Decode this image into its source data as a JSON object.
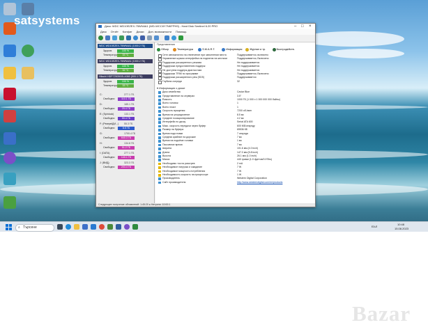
{
  "watermark": "satsystems",
  "window": {
    "title": "Диск: WDC WD10EZEX-75WN4A1 (WD-WCC6Y7NKFPH9) - Hard Disk Sentinel 6.20 PRO",
    "menu": [
      "Диск",
      "Отчёт",
      "Конфиг",
      "Диски",
      "Доп. возможности",
      "Помощь"
    ]
  },
  "disks": [
    {
      "name": "WDC WD10EZEX-75WN4A1 (1000.2 ГБ)",
      "health_label": "Здоров.",
      "health": "100 %",
      "temp_label": "Температура",
      "temp": "33 °C",
      "health_val": 100
    },
    {
      "name": "WDC WD10EZEX-75WN4A1 (1000.2 ГБ)",
      "health_label": "Здоров.",
      "health": "100 %",
      "temp_label": "Температура",
      "temp": "32 °C",
      "health_val": 100
    },
    {
      "name": "Hitachi HDP725050GLA360 (500.1 ГБ)",
      "health_label": "Здоров.",
      "health": "100 %",
      "temp_label": "Температура",
      "temp": "33 °C",
      "health_val": 100
    }
  ],
  "volumes": [
    {
      "letter": "C:",
      "cap": "277.1 ГБ",
      "free_label": "Свободно",
      "free": "110.1 ГБ",
      "color": "#8e3cc8"
    },
    {
      "letter": "D:",
      "cap": "185.1 ГБ",
      "free_label": "Свободно",
      "free": "25.4 ГБ",
      "color": "#8e3cc8"
    },
    {
      "letter": "E: (Spinlock)",
      "cap": "133.1 ГБ",
      "free_label": "Свободно",
      "free": "59.4 ГБ",
      "color": "#6a3cc8"
    },
    {
      "letter": "F: (Резерв/ДИ...)",
      "cap": "55.3 ГБ",
      "free_label": "Свободно",
      "free": "8.5 ГБ",
      "color": "#2f5ccc"
    },
    {
      "letter": "G:",
      "cap": "1700.4 ГБ",
      "free_label": "Свободно",
      "free": "640.3 ГБ",
      "color": "#c83cae"
    },
    {
      "letter": "H:",
      "cap": "134.8 ГБ",
      "free_label": "Свободно",
      "free": "51.2 ГБ",
      "color": "#c83cae"
    },
    {
      "letter": "I: (DATA)",
      "cap": "277.1 ГБ",
      "free_label": "Свободно",
      "free": "140.1 ГБ",
      "color": "#c83cae"
    },
    {
      "letter": "J: (ВИД)",
      "cap": "323.3 ГБ",
      "free_label": "Свободно",
      "free": "203.4 ГБ",
      "color": "#c83cae"
    }
  ],
  "tabs": [
    "Обзор",
    "Температура",
    "S.M.A.R.T.",
    "Информация",
    "Журнал и тр.",
    "Быстродейств."
  ],
  "features_head": "Представления",
  "features": [
    {
      "k": "Сетл автоматично на отвлечение при заполнении места",
      "v": "Поддерживается, включено"
    },
    {
      "k": "Управление шумом интерфейса на поднятии на жестком",
      "v": "Поддерживается, Включено"
    },
    {
      "k": "Поддержка расширенного режима",
      "v": "Не поддерживается"
    },
    {
      "k": "Поддержка предоставлению поддерж",
      "v": "Не поддерживается"
    },
    {
      "k": "Не доступна поддерж диагностики",
      "v": "Не поддерживается"
    },
    {
      "k": "Поддержка TRIM по программе",
      "v": "Поддерживается, Включено"
    },
    {
      "k": "Поддержка расширенного реж (SDS)",
      "v": "Поддерживается"
    },
    {
      "k": "Глубина очереди",
      "v": "32"
    }
  ],
  "info_head": "Информация о диске",
  "info": [
    {
      "k": "Диск семейства",
      "v": "Caviar Blue",
      "w": false
    },
    {
      "k": "Представление на серверах",
      "v": "3.5\"",
      "w": false
    },
    {
      "k": "Ёмкость",
      "v": "1000 ГБ (1 000 x 1 000 000 000 байты)",
      "w": false
    },
    {
      "k": "Всего головок",
      "v": "1",
      "w": false
    },
    {
      "k": "Всего пласт",
      "v": "1",
      "w": false
    },
    {
      "k": "Скорость вращения",
      "v": "7200 об./мин",
      "w": false
    },
    {
      "k": "Время на упорядочение",
      "v": "8.5 мс",
      "w": false
    },
    {
      "k": "Среднее позиционирование",
      "v": "4.2 мс",
      "w": false
    },
    {
      "k": "Интерфейс по диску",
      "v": "Serial ATA 600",
      "w": false
    },
    {
      "k": "Макс. скорость передачи через буфер",
      "v": "600 МБ/секунду",
      "w": false
    },
    {
      "k": "Размер на буфера",
      "v": "65536 КБ",
      "w": false
    },
    {
      "k": "Время подготовки",
      "v": "7 секунда",
      "w": false
    },
    {
      "k": "Средняя крайние на дорожке",
      "v": "7 мс",
      "w": false
    },
    {
      "k": "Время на подъёме головки",
      "v": "1 мс",
      "w": false
    },
    {
      "k": "Пассивное время",
      "v": "7 мс",
      "w": false
    },
    {
      "k": "Ширина",
      "v": "101.6 мм (4.0 inch)",
      "w": false
    },
    {
      "k": "Длина",
      "v": "147.0 мм (5.8 inch)",
      "w": false
    },
    {
      "k": "Высота",
      "v": "26.1 мм (1.0 inch)",
      "w": false
    },
    {
      "k": "Масса",
      "v": "440 грамм (1.0 фунтов/0.97lbs)",
      "w": false
    },
    {
      "k": "Необходимо ток на разогрев",
      "v": "2 mA",
      "w": true
    },
    {
      "k": "Необходимое нагрузка и ожидание",
      "v": "7 W",
      "w": true
    },
    {
      "k": "Необходимое мощность потребления",
      "v": "7 W",
      "w": true
    },
    {
      "k": "Необходимость скорость на процессоре",
      "v": "1 W",
      "w": true
    },
    {
      "k": "Производитель",
      "v": "Western Digital Corporation",
      "w": false
    },
    {
      "k": "Сайт производителя",
      "v": "http://www.westerndigital.com/en/products",
      "w": false,
      "link": true
    }
  ],
  "status": "Следующее получение обновлений: 1:45:20 ● Нетрони: 10:00:1",
  "taskbar": {
    "search_placeholder": "Търсене",
    "tray_time": "10:48",
    "tray_date": "15.08.2023",
    "tray_lang": "БЪЛ"
  },
  "logo": "Bazar"
}
